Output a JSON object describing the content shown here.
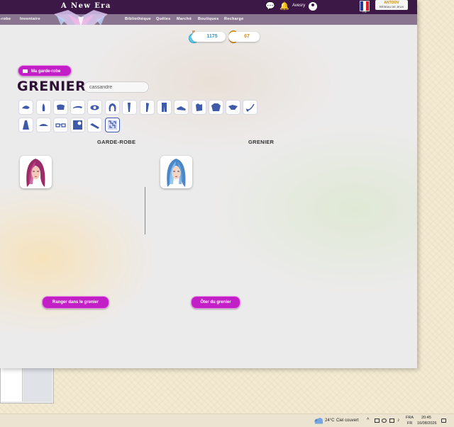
{
  "header": {
    "title": "A New Era",
    "user_name": "Avesry",
    "lang": "FR",
    "partner_brand": "ANTOOV",
    "partner_sub": "RÉSEAU DE JEUX"
  },
  "nav": {
    "items": [
      "-robe",
      "Inventaire",
      "Bibliothèque",
      "Quêtes",
      "Marché",
      "Boutiques",
      "Recharge"
    ]
  },
  "resources": {
    "potions": "1175",
    "coins": "67"
  },
  "wardrobe_button": "Ma garde-robe",
  "page_title": "GRENIER",
  "search": {
    "value": "cassandre"
  },
  "categories_row1": [
    "hat-icon",
    "torso-icon",
    "heart-top-icon",
    "brow-icon",
    "eye-icon",
    "hair-icon",
    "leg-icon",
    "leg-alt-icon",
    "pants-icon",
    "shoes-icon",
    "gloves-icon",
    "jacket-icon",
    "accessory-icon",
    "necklace-icon"
  ],
  "categories_row2": [
    "dress-icon",
    "cap-icon",
    "glasses-icon",
    "background-icon",
    "brush-icon",
    "pattern-icon"
  ],
  "columns": {
    "left": "GARDE-ROBE",
    "right": "GRENIER"
  },
  "buttons": {
    "store": "Ranger dans le grenier",
    "remove": "Ôter du grenier"
  },
  "colors": {
    "accent": "#c21fc6",
    "header": "#3b1846",
    "nav": "#8a7590"
  },
  "taskbar": {
    "weather": "24°C",
    "weather_desc": "Ciel couvert",
    "lang_top": "FRA",
    "lang_bottom": "FR",
    "time": "20:45",
    "date": "16/08/2026"
  }
}
